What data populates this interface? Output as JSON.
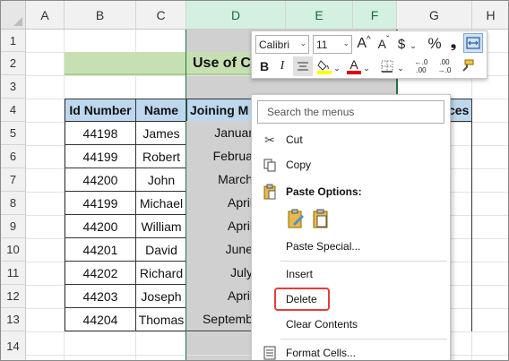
{
  "columns": [
    "A",
    "B",
    "C",
    "D",
    "E",
    "F",
    "G",
    "H"
  ],
  "rows": [
    "1",
    "2",
    "3",
    "4",
    "5",
    "6",
    "7",
    "8",
    "9",
    "10",
    "11",
    "12",
    "13",
    "14"
  ],
  "sheet": {
    "title": "Use of C",
    "headers": [
      "Id Number",
      "Name",
      "Joining M"
    ],
    "header_cut": "ces",
    "ids": [
      "44198",
      "44199",
      "44200",
      "44199",
      "44200",
      "44201",
      "44202",
      "44203",
      "44204"
    ],
    "names": [
      "James",
      "Robert",
      "John",
      "Michael",
      "William",
      "David",
      "Richard",
      "Joseph",
      "Thomas"
    ],
    "months": [
      "Januar",
      "Februa",
      "March",
      "April",
      "April",
      "June",
      "July",
      "April",
      "Septemb"
    ]
  },
  "mini_toolbar": {
    "font": "Calibri",
    "size": "11",
    "grow": "A˄",
    "shrink": "A˅",
    "currency": "$",
    "percent": "%",
    "comma": "❟",
    "bold": "B",
    "italic": "I",
    "fontcolor": "A",
    "dec_inc": "←.0\n.00",
    "dec_dec": ".00\n→.0"
  },
  "context_menu": {
    "search_placeholder": "Search the menus",
    "cut": "Cut",
    "copy": "Copy",
    "paste_options": "Paste Options:",
    "paste_special": "Paste Special...",
    "insert": "Insert",
    "delete": "Delete",
    "clear_contents": "Clear Contents",
    "format_cells": "Format Cells..."
  },
  "colors": {
    "header_fill": "#bdd7ee",
    "title_fill": "#c6e0b4",
    "selected_col": "#d0d0d0",
    "highlight": "#e0403c"
  }
}
